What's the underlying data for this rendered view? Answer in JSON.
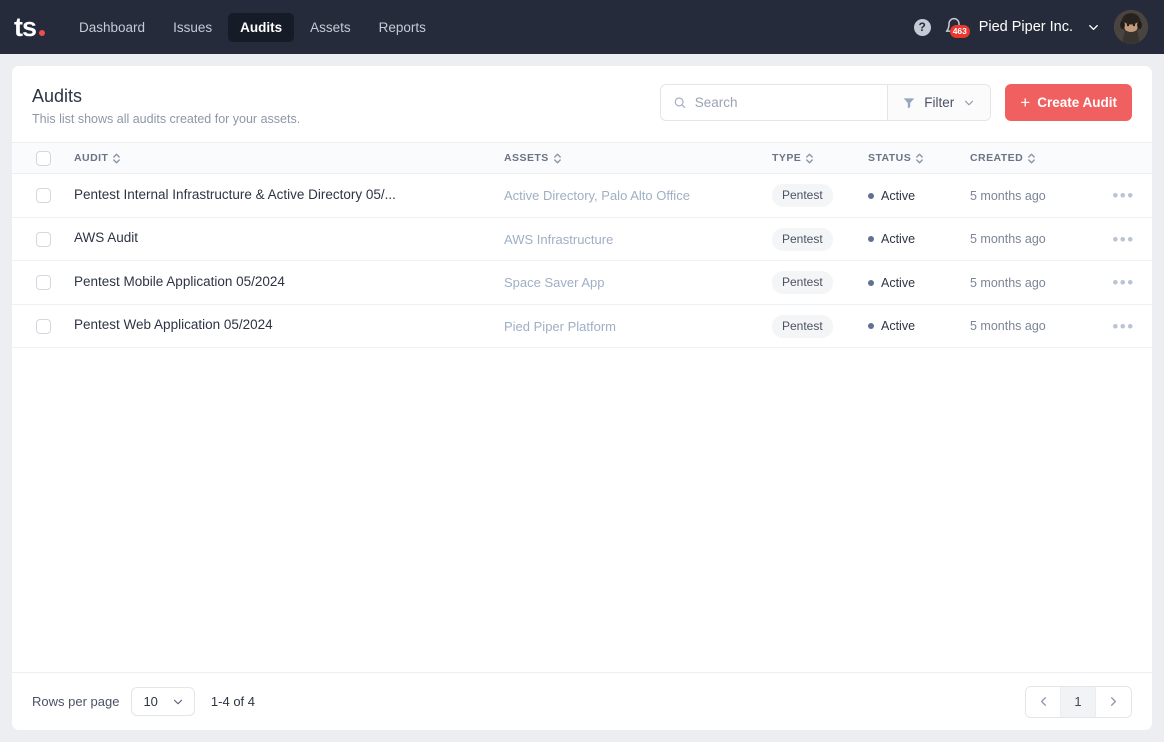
{
  "nav": {
    "logo_text": "ts",
    "items": [
      {
        "label": "Dashboard",
        "active": false
      },
      {
        "label": "Issues",
        "active": false
      },
      {
        "label": "Audits",
        "active": true
      },
      {
        "label": "Assets",
        "active": false
      },
      {
        "label": "Reports",
        "active": false
      }
    ],
    "help_label": "?",
    "notification_count": "463",
    "org_name": "Pied Piper Inc."
  },
  "header": {
    "title": "Audits",
    "subtitle": "This list shows all audits created for your assets.",
    "search_placeholder": "Search",
    "search_value": "",
    "filter_label": "Filter",
    "create_label": "Create Audit",
    "create_color": "#f06060"
  },
  "table": {
    "columns": [
      {
        "key": "audit",
        "label": "AUDIT"
      },
      {
        "key": "assets",
        "label": "ASSETS"
      },
      {
        "key": "type",
        "label": "TYPE"
      },
      {
        "key": "status",
        "label": "STATUS"
      },
      {
        "key": "created",
        "label": "CREATED"
      }
    ],
    "rows": [
      {
        "audit": "Pentest Internal Infrastructure & Active Directory 05/...",
        "assets": "Active Directory, Palo Alto Office",
        "type": "Pentest",
        "status": "Active",
        "created": "5 months ago"
      },
      {
        "audit": "AWS Audit",
        "assets": "AWS Infrastructure",
        "type": "Pentest",
        "status": "Active",
        "created": "5 months ago"
      },
      {
        "audit": "Pentest Mobile Application 05/2024",
        "assets": "Space Saver App",
        "type": "Pentest",
        "status": "Active",
        "created": "5 months ago"
      },
      {
        "audit": "Pentest Web Application 05/2024",
        "assets": "Pied Piper Platform",
        "type": "Pentest",
        "status": "Active",
        "created": "5 months ago"
      }
    ]
  },
  "footer": {
    "rows_per_page_label": "Rows per page",
    "rows_per_page_value": "10",
    "range_label": "1-4 of 4",
    "current_page": "1"
  }
}
